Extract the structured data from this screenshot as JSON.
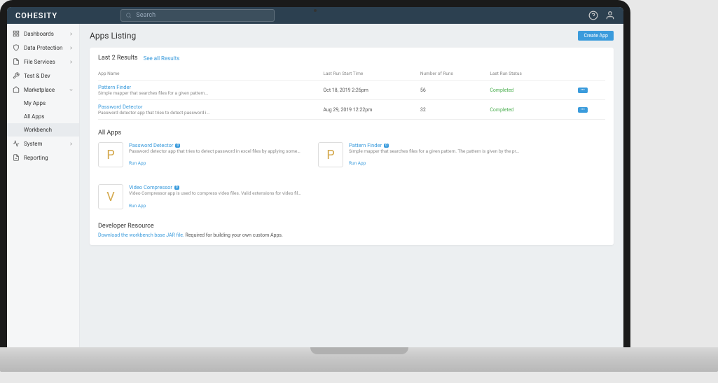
{
  "brand": "COHESITY",
  "search": {
    "placeholder": "Search"
  },
  "sidebar": {
    "items": [
      {
        "label": "Dashboards"
      },
      {
        "label": "Data Protection"
      },
      {
        "label": "File Services"
      },
      {
        "label": "Test & Dev"
      },
      {
        "label": "Marketplace"
      },
      {
        "label": "System"
      },
      {
        "label": "Reporting"
      }
    ],
    "marketplace_sub": [
      {
        "label": "My Apps"
      },
      {
        "label": "All Apps"
      },
      {
        "label": "Workbench"
      }
    ]
  },
  "page": {
    "title": "Apps Listing",
    "create_btn": "Create App"
  },
  "results": {
    "header": "Last 2 Results",
    "see_all": "See all Results",
    "columns": {
      "name": "App Name",
      "start": "Last Run Start Time",
      "runs": "Number of Runs",
      "status": "Last Run Status"
    },
    "rows": [
      {
        "name": "Pattern Finder",
        "desc": "Simple mapper that searches files for a given pattern...",
        "start": "Oct 18, 2019 2:26pm",
        "runs": "56",
        "status": "Completed"
      },
      {
        "name": "Password Detector",
        "desc": "Password detector app that tries to detect password i...",
        "start": "Aug 29, 2019 12:22pm",
        "runs": "32",
        "status": "Completed"
      }
    ]
  },
  "all_apps": {
    "title": "All Apps",
    "cards": [
      {
        "letter": "P",
        "name": "Password Detector",
        "badge": "0",
        "desc": "Password detector app that tries to detect password in excel files by applying some heuristics.",
        "run": "Run App"
      },
      {
        "letter": "P",
        "name": "Pattern Finder",
        "badge": "0",
        "desc": "Simple mapper that searches files for a given pattern. The pattern is given by the property 'searchPatt...",
        "run": "Run App"
      },
      {
        "letter": "V",
        "name": "Video Compressor",
        "badge": "0",
        "desc": "Video Compressor app is used to compress video files. Valid extensions for video files are given by...",
        "run": "Run App"
      }
    ]
  },
  "dev": {
    "title": "Developer Resource",
    "link": "Download the workbench base JAR file.",
    "text": " Required for building your own custom Apps."
  }
}
